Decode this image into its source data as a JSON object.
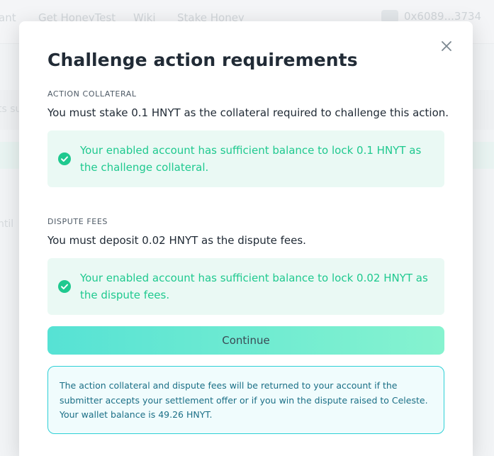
{
  "background": {
    "nav": [
      {
        "label": "ant"
      },
      {
        "label": "Get HoneyTest"
      },
      {
        "label": "Wiki"
      },
      {
        "label": "Stake Honey"
      }
    ],
    "account_address": "0x6089...3734",
    "row_snippets": [
      "ts su",
      "ntil"
    ]
  },
  "modal": {
    "title": "Challenge action requirements",
    "collateral": {
      "label": "ACTION COLLATERAL",
      "description": "You must stake 0.1 HNYT as the collateral required to challenge this action.",
      "status": "Your enabled account has sufficient balance to lock 0.1 HNYT as the challenge collateral."
    },
    "fees": {
      "label": "DISPUTE FEES",
      "description": "You must deposit 0.02 HNYT as the dispute fees.",
      "status": "Your enabled account has sufficient balance to lock 0.02 HNYT as the dispute fees."
    },
    "continue_label": "Continue",
    "info": "The action collateral and dispute fees will be returned to your account if the submitter accepts your settlement offer or if you win the dispute raised to Celeste. Your wallet balance is 49.26 HNYT."
  },
  "colors": {
    "success_text": "#1fc98f",
    "success_bg": "#eaf9f4",
    "info_border": "#2ed0d6",
    "info_text": "#1b6f86"
  },
  "icons": {
    "close": "close-icon",
    "check": "check-circle-icon"
  }
}
